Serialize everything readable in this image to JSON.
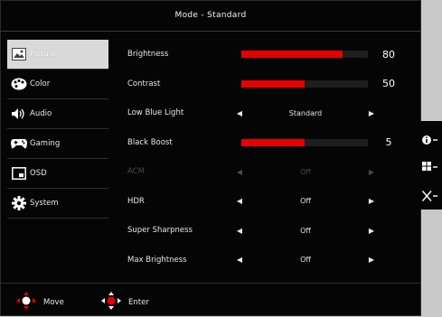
{
  "header": {
    "title": "Mode - Standard"
  },
  "sidebar": {
    "items": [
      {
        "label": "Picture",
        "icon": "picture-icon",
        "active": true
      },
      {
        "label": "Color",
        "icon": "palette-icon"
      },
      {
        "label": "Audio",
        "icon": "speaker-icon"
      },
      {
        "label": "Gaming",
        "icon": "gamepad-icon"
      },
      {
        "label": "OSD",
        "icon": "osd-icon"
      },
      {
        "label": "System",
        "icon": "gear-icon"
      }
    ]
  },
  "settings": {
    "brightness": {
      "label": "Brightness",
      "value": "80",
      "level": 80
    },
    "contrast": {
      "label": "Contrast",
      "value": "50",
      "level": 50
    },
    "low_blue_light": {
      "label": "Low Blue Light",
      "value": "Standard"
    },
    "black_boost": {
      "label": "Black Boost",
      "value": "5",
      "level": 50
    },
    "acm": {
      "label": "ACM",
      "value": "Off",
      "enabled": false
    },
    "hdr": {
      "label": "HDR",
      "value": "Off"
    },
    "super_sharpness": {
      "label": "Super Sharpness",
      "value": "Off"
    },
    "max_brightness": {
      "label": "Max Brightness",
      "value": "Off"
    }
  },
  "footer": {
    "move_label": "Move",
    "enter_label": "Enter"
  },
  "side_panel": {
    "buttons": [
      {
        "icon": "info-icon"
      },
      {
        "icon": "mode-grid-icon"
      },
      {
        "icon": "close-icon"
      }
    ]
  },
  "colors": {
    "accent": "#e60000",
    "background": "#050505",
    "active_tab": "#d9d9d9"
  }
}
